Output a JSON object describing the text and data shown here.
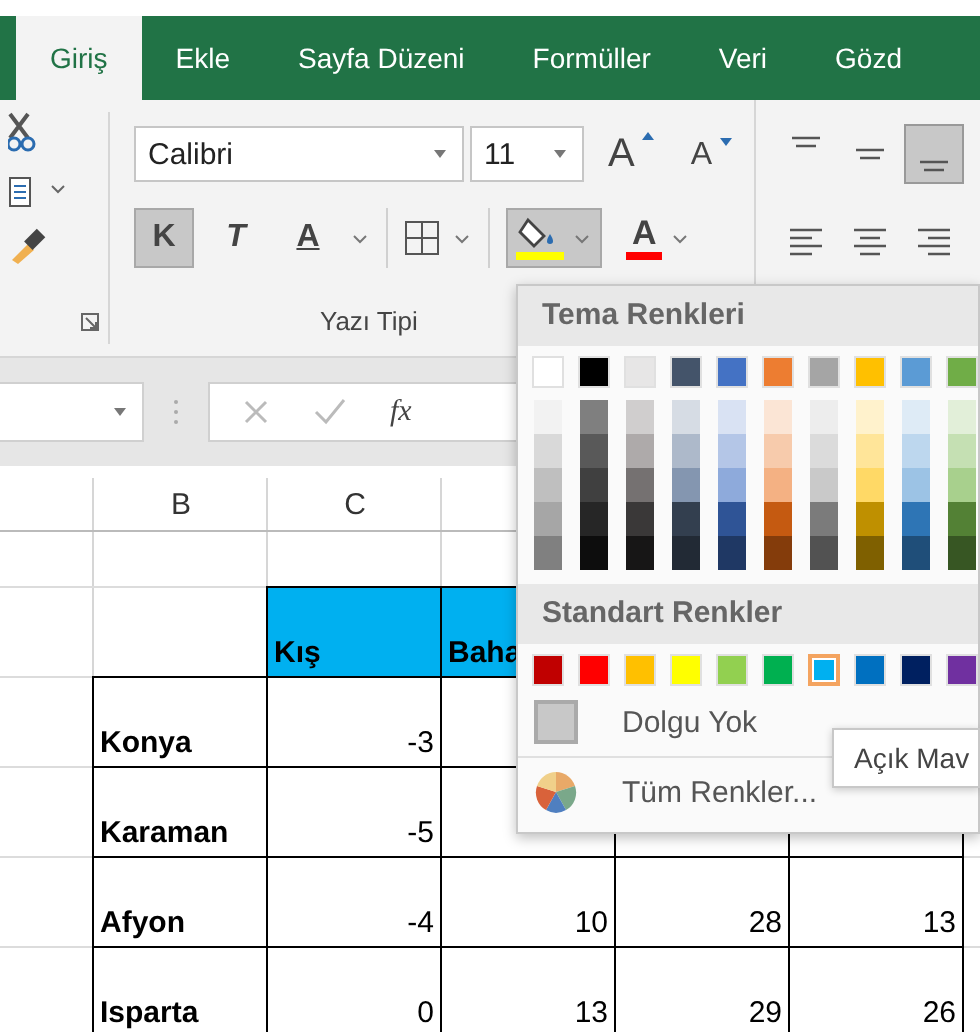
{
  "tabs": [
    {
      "label": "Giriş",
      "selected": true
    },
    {
      "label": "Ekle",
      "selected": false
    },
    {
      "label": "Sayfa Düzeni",
      "selected": false
    },
    {
      "label": "Formüller",
      "selected": false
    },
    {
      "label": "Veri",
      "selected": false
    },
    {
      "label": "Gözd",
      "selected": false
    }
  ],
  "font": {
    "name": "Calibri",
    "size": "11",
    "grow": "A",
    "shrink": "A",
    "group_label": "Yazı Tipi"
  },
  "format_buttons": [
    {
      "label": "K",
      "kind": "bold",
      "selected": true
    },
    {
      "label": "T",
      "kind": "italic",
      "selected": false
    },
    {
      "label": "A",
      "kind": "underline",
      "selected": false
    }
  ],
  "fill_button": {
    "selected": true,
    "color": "#ffff00"
  },
  "font_color_button": {
    "label": "A",
    "color": "#ff0000"
  },
  "align_buttons": [
    {
      "kind": "top",
      "selected": false
    },
    {
      "kind": "middle",
      "selected": false
    },
    {
      "kind": "bottom",
      "selected": true
    },
    {
      "kind": "left",
      "selected": false
    },
    {
      "kind": "center",
      "selected": false
    },
    {
      "kind": "right",
      "selected": false
    }
  ],
  "formula_bar": {
    "fx": "fx"
  },
  "sheet": {
    "columns": [
      "B",
      "C"
    ],
    "rows": [
      {
        "cells": [
          "",
          "Kış",
          "Baha",
          "",
          ""
        ]
      },
      {
        "cells": [
          "Konya",
          "-3",
          "",
          "",
          ""
        ]
      },
      {
        "cells": [
          "Karaman",
          "-5",
          "",
          "",
          ""
        ]
      },
      {
        "cells": [
          "Afyon",
          "-4",
          "10",
          "28",
          "13"
        ]
      },
      {
        "cells": [
          "Isparta",
          "0",
          "13",
          "29",
          "26"
        ]
      }
    ]
  },
  "color_menu": {
    "theme_title": "Tema Renkleri",
    "theme": [
      {
        "color": "#ffffff",
        "shades": [
          {
            "color": "#f2f2f2"
          },
          {
            "color": "#d9d9d9"
          },
          {
            "color": "#bfbfbf"
          },
          {
            "color": "#a6a6a6"
          },
          {
            "color": "#808080"
          }
        ]
      },
      {
        "color": "#000000",
        "shades": [
          {
            "color": "#7f7f7f"
          },
          {
            "color": "#595959"
          },
          {
            "color": "#404040"
          },
          {
            "color": "#262626"
          },
          {
            "color": "#0d0d0d"
          }
        ]
      },
      {
        "color": "#e7e6e6",
        "shades": [
          {
            "color": "#d0cece"
          },
          {
            "color": "#aeaaaa"
          },
          {
            "color": "#757171"
          },
          {
            "color": "#3a3838"
          },
          {
            "color": "#171616"
          }
        ]
      },
      {
        "color": "#44546a",
        "shades": [
          {
            "color": "#d6dce4"
          },
          {
            "color": "#adb9ca"
          },
          {
            "color": "#8496b0"
          },
          {
            "color": "#333f4f"
          },
          {
            "color": "#222a35"
          }
        ]
      },
      {
        "color": "#4472c4",
        "shades": [
          {
            "color": "#d9e2f3"
          },
          {
            "color": "#b4c6e7"
          },
          {
            "color": "#8eaadb"
          },
          {
            "color": "#2f5496"
          },
          {
            "color": "#1f3864"
          }
        ]
      },
      {
        "color": "#ed7d31",
        "shades": [
          {
            "color": "#fbe5d5"
          },
          {
            "color": "#f7cbac"
          },
          {
            "color": "#f4b183"
          },
          {
            "color": "#c55a11"
          },
          {
            "color": "#843c0b"
          }
        ]
      },
      {
        "color": "#a5a5a5",
        "shades": [
          {
            "color": "#ededed"
          },
          {
            "color": "#dbdbdb"
          },
          {
            "color": "#c9c9c9"
          },
          {
            "color": "#7b7b7b"
          },
          {
            "color": "#525252"
          }
        ]
      },
      {
        "color": "#ffc000",
        "shades": [
          {
            "color": "#fff2cc"
          },
          {
            "color": "#ffe599"
          },
          {
            "color": "#ffd966"
          },
          {
            "color": "#bf9000"
          },
          {
            "color": "#7f6000"
          }
        ]
      },
      {
        "color": "#5b9bd5",
        "shades": [
          {
            "color": "#deebf6"
          },
          {
            "color": "#bdd7ee"
          },
          {
            "color": "#9cc3e5"
          },
          {
            "color": "#2e75b5"
          },
          {
            "color": "#1f4e79"
          }
        ]
      },
      {
        "color": "#70ad47",
        "shades": [
          {
            "color": "#e2efd9"
          },
          {
            "color": "#c5e0b3"
          },
          {
            "color": "#a8d08d"
          },
          {
            "color": "#538135"
          },
          {
            "color": "#375623"
          }
        ]
      }
    ],
    "standard_title": "Standart Renkler",
    "standard": [
      {
        "color": "#c00000",
        "selected": false
      },
      {
        "color": "#ff0000",
        "selected": false
      },
      {
        "color": "#ffc000",
        "selected": false
      },
      {
        "color": "#ffff00",
        "selected": false
      },
      {
        "color": "#92d050",
        "selected": false
      },
      {
        "color": "#00b050",
        "selected": false
      },
      {
        "color": "#00b0f0",
        "selected": true
      },
      {
        "color": "#0070c0",
        "selected": false
      },
      {
        "color": "#002060",
        "selected": false
      },
      {
        "color": "#7030a0",
        "selected": false
      }
    ],
    "no_fill": "Dolgu Yok",
    "more_colors": "Tüm Renkler...",
    "tooltip": "Açık Mav"
  }
}
